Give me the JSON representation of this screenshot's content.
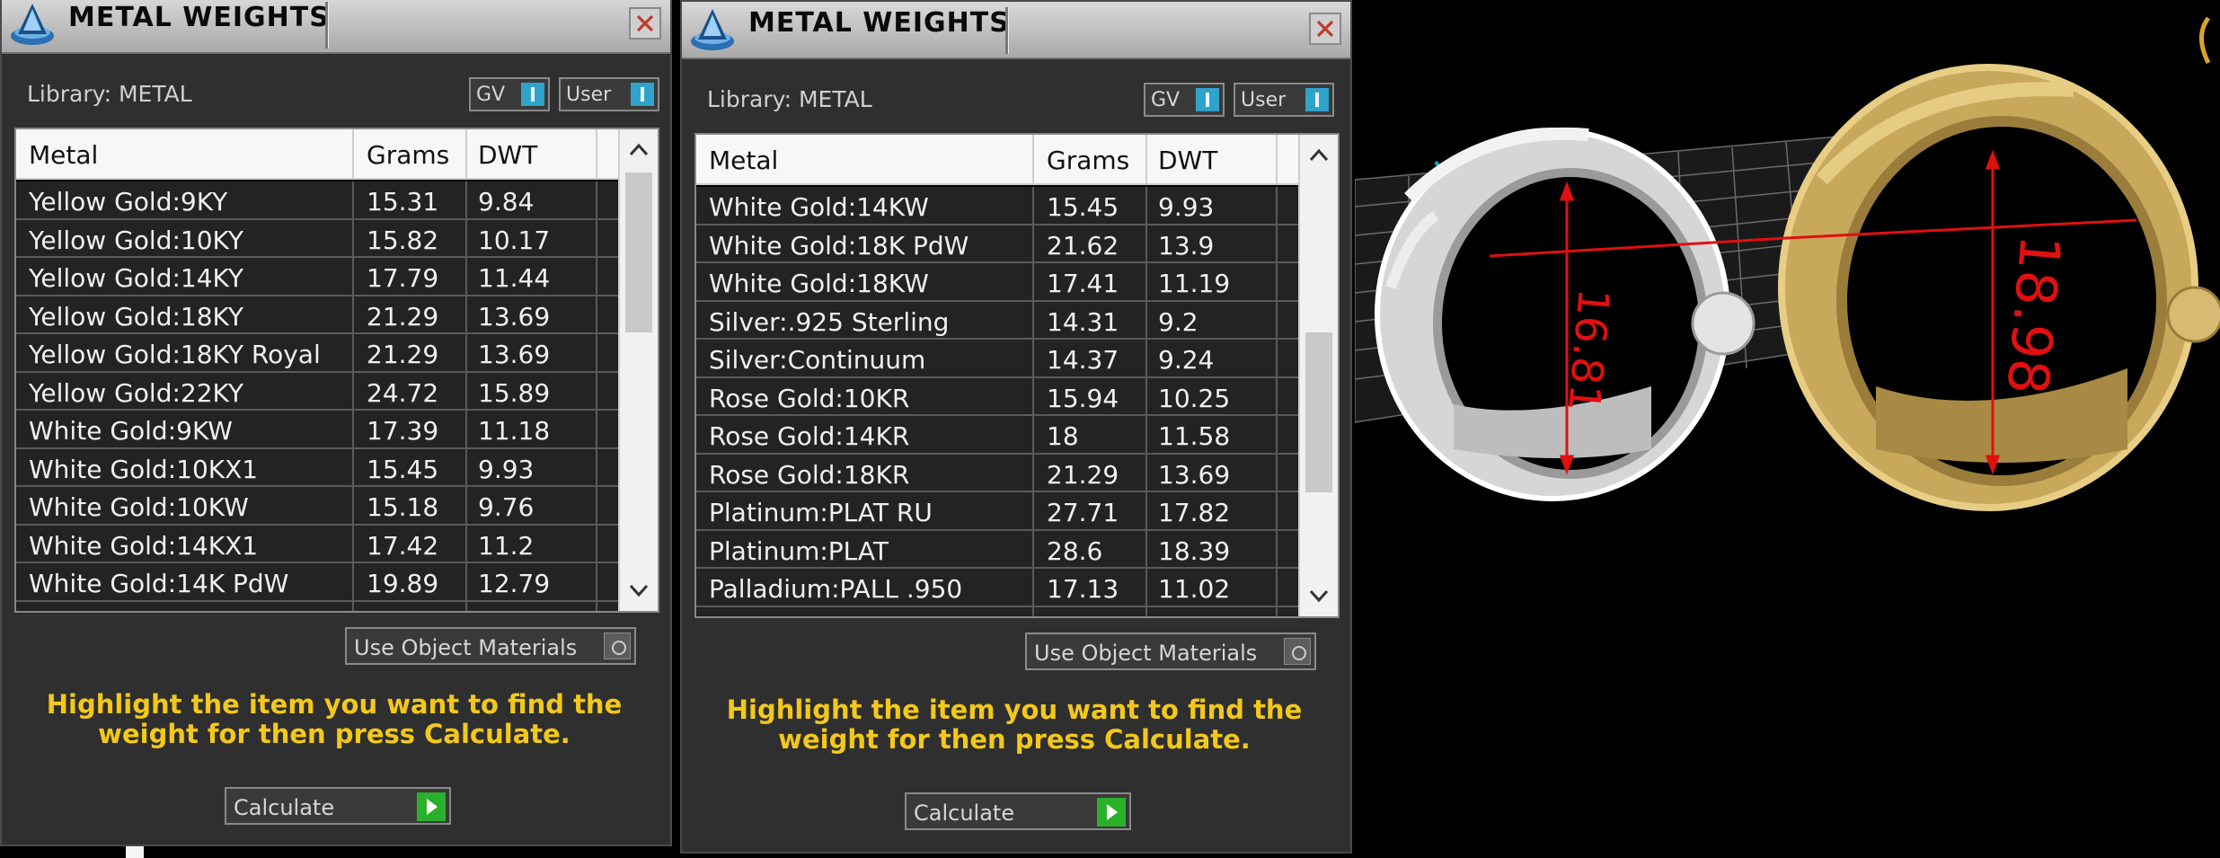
{
  "panels": [
    {
      "title": "METAL WEIGHTS",
      "library_label": "Library: METAL",
      "toggle_gv": "GV",
      "toggle_user": "User",
      "columns": [
        "Metal",
        "Grams",
        "DWT"
      ],
      "rows": [
        {
          "metal": "Yellow Gold:9KY",
          "grams": "15.31",
          "dwt": "9.84"
        },
        {
          "metal": "Yellow Gold:10KY",
          "grams": "15.82",
          "dwt": "10.17"
        },
        {
          "metal": "Yellow Gold:14KY",
          "grams": "17.79",
          "dwt": "11.44"
        },
        {
          "metal": "Yellow Gold:18KY",
          "grams": "21.29",
          "dwt": "13.69"
        },
        {
          "metal": "Yellow Gold:18KY Royal",
          "grams": "21.29",
          "dwt": "13.69"
        },
        {
          "metal": "Yellow Gold:22KY",
          "grams": "24.72",
          "dwt": "15.89"
        },
        {
          "metal": "White Gold:9KW",
          "grams": "17.39",
          "dwt": "11.18"
        },
        {
          "metal": "White Gold:10KX1",
          "grams": "15.45",
          "dwt": "9.93"
        },
        {
          "metal": "White Gold:10KW",
          "grams": "15.18",
          "dwt": "9.76"
        },
        {
          "metal": "White Gold:14KX1",
          "grams": "17.42",
          "dwt": "11.2"
        },
        {
          "metal": "White Gold:14K PdW",
          "grams": "19.89",
          "dwt": "12.79"
        }
      ],
      "use_object_materials": "Use Object Materials",
      "instruction": "Highlight the item you want to find the weight for then press Calculate.",
      "calculate": "Calculate"
    },
    {
      "title": "METAL WEIGHTS",
      "library_label": "Library: METAL",
      "toggle_gv": "GV",
      "toggle_user": "User",
      "columns": [
        "Metal",
        "Grams",
        "DWT"
      ],
      "rows": [
        {
          "metal": "White Gold:14KW",
          "grams": "15.45",
          "dwt": "9.93"
        },
        {
          "metal": "White Gold:18K PdW",
          "grams": "21.62",
          "dwt": "13.9"
        },
        {
          "metal": "White Gold:18KW",
          "grams": "17.41",
          "dwt": "11.19"
        },
        {
          "metal": "Silver:.925 Sterling",
          "grams": "14.31",
          "dwt": "9.2"
        },
        {
          "metal": "Silver:Continuum",
          "grams": "14.37",
          "dwt": "9.24"
        },
        {
          "metal": "Rose Gold:10KR",
          "grams": "15.94",
          "dwt": "10.25"
        },
        {
          "metal": "Rose Gold:14KR",
          "grams": "18",
          "dwt": "11.58"
        },
        {
          "metal": "Rose Gold:18KR",
          "grams": "21.29",
          "dwt": "13.69"
        },
        {
          "metal": "Platinum:PLAT RU",
          "grams": "27.71",
          "dwt": "17.82"
        },
        {
          "metal": "Platinum:PLAT",
          "grams": "28.6",
          "dwt": "18.39"
        },
        {
          "metal": "Palladium:PALL .950",
          "grams": "17.13",
          "dwt": "11.02"
        }
      ],
      "use_object_materials": "Use Object Materials",
      "instruction": "Highlight the item you want to find the weight for then press Calculate.",
      "calculate": "Calculate"
    }
  ],
  "viewport": {
    "measure_left": "16.81",
    "measure_right": "18.98"
  },
  "colors": {
    "highlight_text": "#f3c81a",
    "toggle_on": "#2fa3c9",
    "calculate_icon": "#2bb02b",
    "measure": "#e01010"
  }
}
